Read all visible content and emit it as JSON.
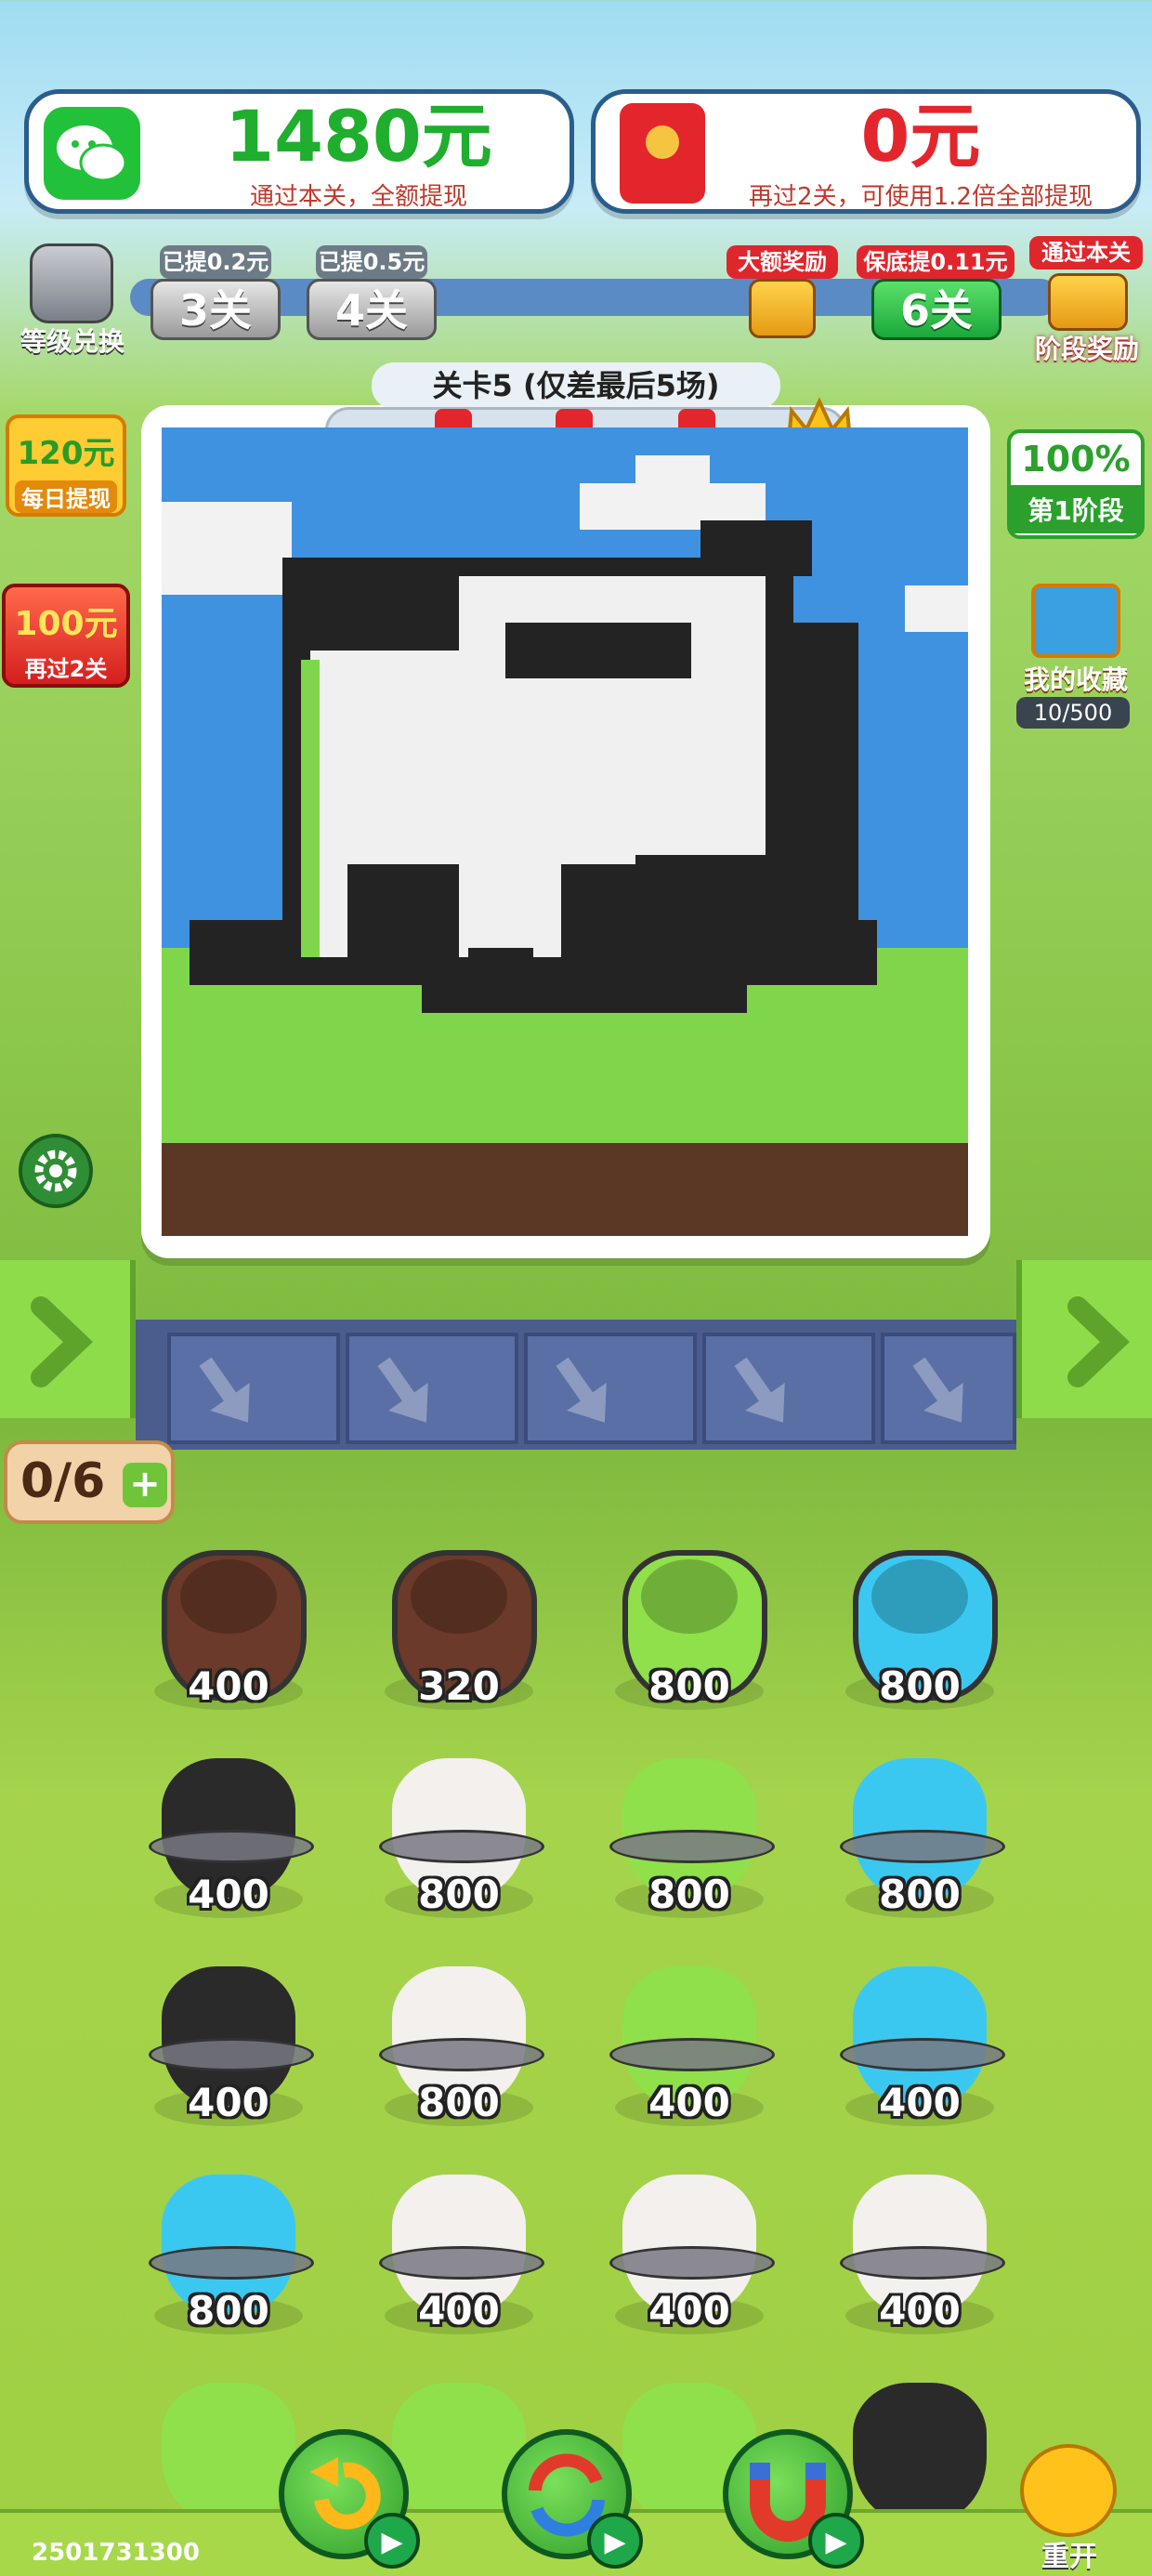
{
  "top_left_card": {
    "amount": "1480元",
    "subtitle": "通过本关，全额提现"
  },
  "top_right_card": {
    "amount": "0元",
    "subtitle": "再过2关，可使用1.2倍全部提现"
  },
  "level_exchange": {
    "label": "等级兑换"
  },
  "milestones": [
    {
      "tag": "已提0.2元",
      "label": "3关"
    },
    {
      "tag": "已提0.5元",
      "label": "4关"
    },
    {
      "tag": "大额奖励",
      "label": ""
    },
    {
      "tag": "保底提0.11元",
      "label": "6关"
    },
    {
      "tag": "通过本关",
      "label": "阶段奖励"
    }
  ],
  "level_title": "关卡5 (仅差最后5场)",
  "daily_withdraw": {
    "amount": "120元",
    "label": "每日提现"
  },
  "pass_two": {
    "amount": "100元",
    "label": "再过2关"
  },
  "progress_panel": {
    "percent": "100%",
    "stage": "第1阶段"
  },
  "collection": {
    "label": "我的收藏",
    "count": "10/500"
  },
  "slot_counter": "0/6",
  "buckets": [
    {
      "color": "#6b3a2a",
      "value": "400",
      "open": true
    },
    {
      "color": "#6b3a2a",
      "value": "320",
      "open": true
    },
    {
      "color": "#8fe04a",
      "value": "800",
      "open": true
    },
    {
      "color": "#3bc8f0",
      "value": "800",
      "open": true
    },
    {
      "color": "#2a2a2a",
      "value": "400",
      "open": false
    },
    {
      "color": "#f4f0ee",
      "value": "800",
      "open": false
    },
    {
      "color": "#8fe04a",
      "value": "800",
      "open": false
    },
    {
      "color": "#3bc8f0",
      "value": "800",
      "open": false
    },
    {
      "color": "#2a2a2a",
      "value": "400",
      "open": false
    },
    {
      "color": "#f4f0ee",
      "value": "800",
      "open": false
    },
    {
      "color": "#8fe04a",
      "value": "400",
      "open": false
    },
    {
      "color": "#3bc8f0",
      "value": "400",
      "open": false
    },
    {
      "color": "#3bc8f0",
      "value": "800",
      "open": false
    },
    {
      "color": "#f4f0ee",
      "value": "400",
      "open": false
    },
    {
      "color": "#f4f0ee",
      "value": "400",
      "open": false
    },
    {
      "color": "#f4f0ee",
      "value": "400",
      "open": false
    }
  ],
  "restart_label": "重开",
  "footer_id": "2501731300"
}
